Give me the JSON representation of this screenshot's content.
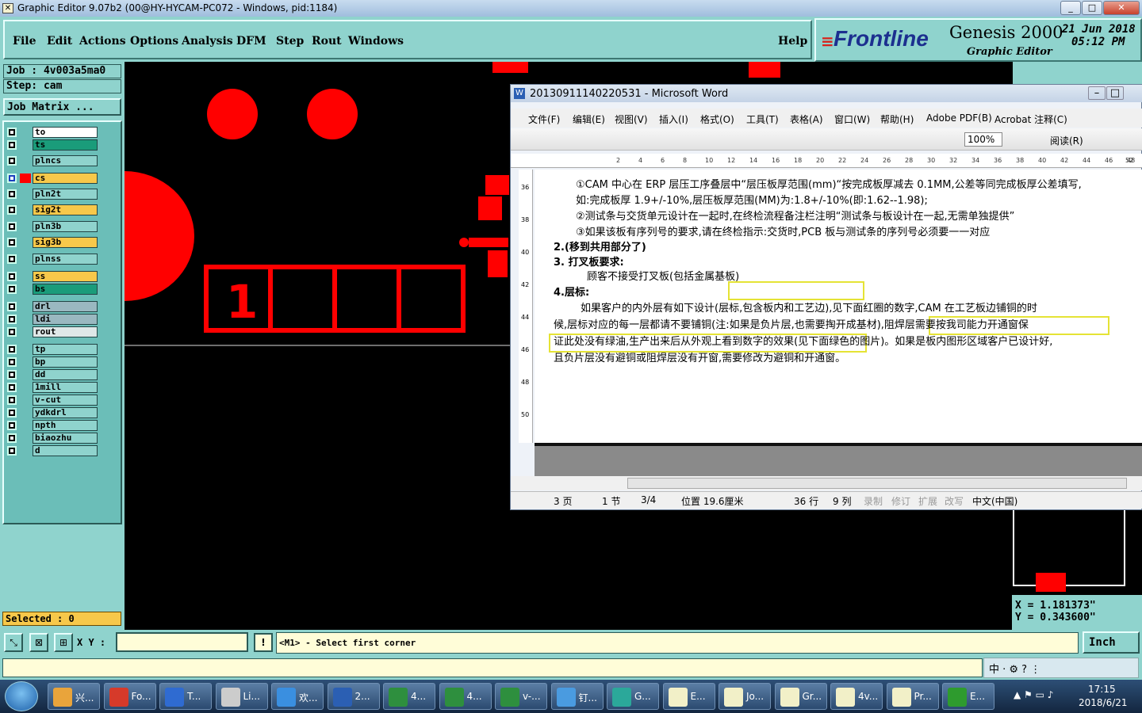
{
  "window": {
    "title": "Graphic Editor 9.07b2 (00@HY-HYCAM-PC072 - Windows, pid:1184)"
  },
  "menu": {
    "items": [
      "File",
      "Edit",
      "Actions",
      "Options",
      "Analysis",
      "DFM",
      "Step",
      "Rout",
      "Windows"
    ],
    "help": "Help"
  },
  "brand": {
    "logo": "Frontline",
    "product": "Genesis 2000",
    "subtitle": "Graphic Editor",
    "date": "21 Jun 2018",
    "time": "05:12 PM"
  },
  "job": {
    "job_line": "Job : 4v003a5ma0",
    "step_line": "Step: cam",
    "matrix_button": "Job Matrix ..."
  },
  "layers": [
    {
      "name": "to",
      "color": "#ffffff"
    },
    {
      "name": "ts",
      "color": "#1a9c7a"
    },
    {
      "name": "plncs",
      "color": "#8fd3cd"
    },
    {
      "name": "cs",
      "color": "#f7c84a"
    },
    {
      "name": "pln2t",
      "color": "#8fd3cd"
    },
    {
      "name": "sig2t",
      "color": "#f7c84a"
    },
    {
      "name": "pln3b",
      "color": "#8fd3cd"
    },
    {
      "name": "sig3b",
      "color": "#f7c84a"
    },
    {
      "name": "plnss",
      "color": "#8fd3cd"
    },
    {
      "name": "ss",
      "color": "#f7c84a"
    },
    {
      "name": "bs",
      "color": "#1a9c7a"
    },
    {
      "name": "drl",
      "color": "#9ab8c0"
    },
    {
      "name": "ldi",
      "color": "#9ab8c0"
    },
    {
      "name": "rout",
      "color": "#dfe8e8"
    },
    {
      "name": "tp",
      "color": "#8fd3cd"
    },
    {
      "name": "bp",
      "color": "#8fd3cd"
    },
    {
      "name": "dd",
      "color": "#8fd3cd"
    },
    {
      "name": "1mill",
      "color": "#8fd3cd"
    },
    {
      "name": "v-cut",
      "color": "#8fd3cd"
    },
    {
      "name": "ydkdrl",
      "color": "#8fd3cd"
    },
    {
      "name": "npth",
      "color": "#8fd3cd"
    },
    {
      "name": "biaozhu",
      "color": "#8fd3cd"
    },
    {
      "name": "d",
      "color": "#8fd3cd"
    }
  ],
  "selected": "Selected : 0",
  "canvas": {
    "digit": "1"
  },
  "coords": {
    "x": "X = 1.181373\"",
    "y": "Y = 0.343600\""
  },
  "status": {
    "xy_label": "X Y :",
    "xy_value": "",
    "prompt": "<M1> - Select first corner",
    "unit": "Inch"
  },
  "word": {
    "title": "20130911140220531 - Microsoft Word",
    "menu": [
      "文件(F)",
      "编辑(E)",
      "视图(V)",
      "插入(I)",
      "格式(O)",
      "工具(T)",
      "表格(A)",
      "窗口(W)",
      "帮助(H)",
      "Adobe PDF(B)",
      "Acrobat 注释(C)"
    ],
    "zoom": "100%",
    "read_mode": "阅读(R)",
    "ruler_h": [
      "2",
      "4",
      "6",
      "8",
      "10",
      "12",
      "14",
      "16",
      "18",
      "20",
      "22",
      "24",
      "26",
      "28",
      "30",
      "32",
      "34",
      "36",
      "38",
      "40",
      "42",
      "44",
      "46",
      "48",
      "52"
    ],
    "ruler_v": [
      "36",
      "38",
      "40",
      "42",
      "44",
      "46",
      "48",
      "50"
    ],
    "lines": [
      "①CAM 中心在 ERP 层压工序叠层中“层压板厚范围(mm)“按完成板厚减去 0.1MM,公差等同完成板厚公差填写,",
      "如:完成板厚 1.9+/-10%,层压板厚范围(MM)为:1.8+/-10%(即:1.62--1.98);",
      "②测试条与交货单元设计在一起时,在终检流程备注栏注明“测试条与板设计在一起,无需单独提供”",
      "③如果该板有序列号的要求,请在终检指示:交货时,PCB 板与测试条的序列号必须要一一对应",
      "2.(移到共用部分了)",
      "3. 打叉板要求:",
      "顾客不接受打叉板(包括金属基板)",
      "4.层标:",
      "如果客户的内外层有如下设计(层标,包含板内和工艺边),见下面红圈的数字,CAM 在工艺板边铺铜的时",
      "候,层标对应的每一层都请不要铺铜(注:如果是负片层,也需要掏开成基材),阻焊层需要按我司能力开通窗保",
      "证此处没有绿油,生产出来后从外观上看到数字的效果(见下面绿色的图片)。如果是板内图形区域客户已设计好,",
      "且负片层没有避铜或阻焊层没有开窗,需要修改为避铜和开通窗。"
    ],
    "status": {
      "page": "3 页",
      "section": "1 节",
      "pages": "3/4",
      "position": "位置 19.6厘米",
      "line": "36 行",
      "col": "9 列",
      "rec": "录制",
      "rev": "修订",
      "ext": "扩展",
      "ovr": "改写",
      "lang": "中文(中国)"
    }
  },
  "taskbar": {
    "items": [
      "兴...",
      "Fo...",
      "T...",
      "Li...",
      "欢...",
      "2...",
      "4...",
      "4...",
      "v-...",
      "钉...",
      "G...",
      "E...",
      "Jo...",
      "Gr...",
      "4v...",
      "Pr...",
      "E..."
    ],
    "time": "17:15",
    "date": "2018/6/21"
  }
}
